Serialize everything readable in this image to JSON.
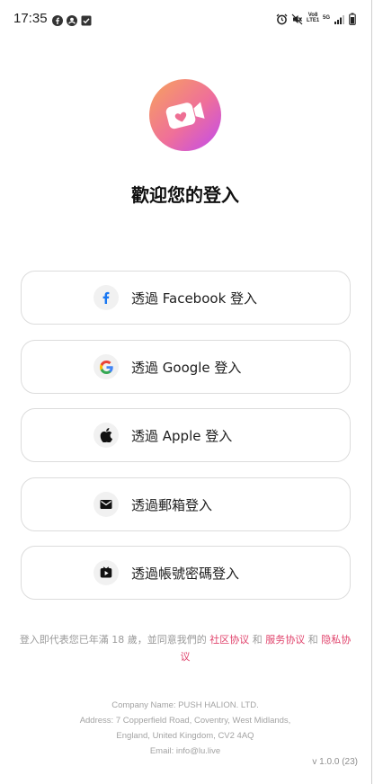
{
  "status_bar": {
    "time": "17:35",
    "left_icons": [
      "facebook-icon",
      "account-icon",
      "checkbox-icon"
    ],
    "right_icons": [
      "alarm-icon",
      "mute-icon",
      "volte-icon",
      "5g-icon",
      "signal-icon",
      "battery-icon"
    ],
    "volte_label": "Vo8 LTE1",
    "network_label": "5G"
  },
  "app": {
    "logo_icon": "video-heart-icon",
    "welcome_title": "歡迎您的登入"
  },
  "login_options": [
    {
      "icon": "facebook-icon",
      "label": "透過 Facebook 登入"
    },
    {
      "icon": "google-icon",
      "label": "透過 Google 登入"
    },
    {
      "icon": "apple-icon",
      "label": "透過 Apple 登入"
    },
    {
      "icon": "mail-icon",
      "label": "透過郵箱登入"
    },
    {
      "icon": "play-box-icon",
      "label": "透過帳號密碼登入"
    }
  ],
  "terms": {
    "prefix": "登入即代表您已年滿 18 歲，並同意我們的 ",
    "community_link": "社区协议",
    "and1": " 和 ",
    "service_link": "服务协议",
    "and2": " 和 ",
    "privacy_link": "隐私协议"
  },
  "company": {
    "name_line": "Company Name: PUSH HALION. LTD.",
    "address_line1": "Address: 7 Copperfield Road, Coventry, West Midlands,",
    "address_line2": "England, United Kingdom, CV2 4AQ",
    "email_line": "Email: info@lu.live"
  },
  "version": "v 1.0.0 (23)",
  "colors": {
    "accent_link": "#e0426b",
    "logo_gradient_start": "#f7a35c",
    "logo_gradient_end": "#c04af0",
    "facebook_blue": "#1877f2"
  }
}
